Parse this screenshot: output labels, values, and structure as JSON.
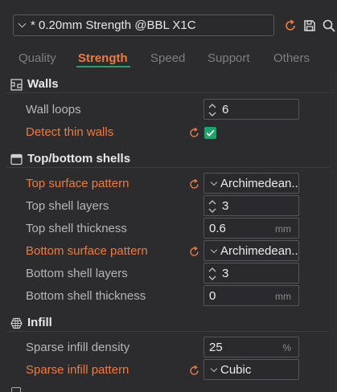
{
  "preset": {
    "name": "* 0.20mm Strength @BBL X1C"
  },
  "tabs": [
    {
      "label": "Quality",
      "active": false
    },
    {
      "label": "Strength",
      "active": true
    },
    {
      "label": "Speed",
      "active": false
    },
    {
      "label": "Support",
      "active": false
    },
    {
      "label": "Others",
      "active": false
    }
  ],
  "colors": {
    "accent": "#f07a3c",
    "active_underline": "#1fa36a",
    "checkbox": "#1fa36a"
  },
  "sections": {
    "walls": {
      "title": "Walls",
      "wall_loops": {
        "label": "Wall loops",
        "value": "6"
      },
      "detect_thin_walls": {
        "label": "Detect thin walls",
        "checked": true
      }
    },
    "shells": {
      "title": "Top/bottom shells",
      "top_surface_pattern": {
        "label": "Top surface pattern",
        "value": "Archimedean..."
      },
      "top_shell_layers": {
        "label": "Top shell layers",
        "value": "3"
      },
      "top_shell_thickness": {
        "label": "Top shell thickness",
        "value": "0.6",
        "unit": "mm"
      },
      "bottom_surface_pattern": {
        "label": "Bottom surface pattern",
        "value": "Archimedean..."
      },
      "bottom_shell_layers": {
        "label": "Bottom shell layers",
        "value": "3"
      },
      "bottom_shell_thickness": {
        "label": "Bottom shell thickness",
        "value": "0",
        "unit": "mm"
      }
    },
    "infill": {
      "title": "Infill",
      "sparse_infill_density": {
        "label": "Sparse infill density",
        "value": "25",
        "unit": "%"
      },
      "sparse_infill_pattern": {
        "label": "Sparse infill pattern",
        "value": "Cubic"
      }
    }
  }
}
